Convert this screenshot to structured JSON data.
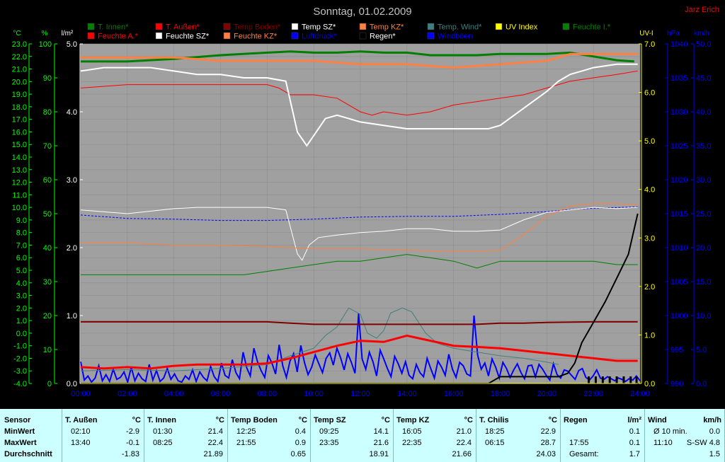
{
  "header": {
    "date_title": "Sonntag, 01.02.2009",
    "author": "Jarz Erich"
  },
  "colors": {
    "t_innen": "#007f00",
    "t_aussen": "#ff0000",
    "temp_boden": "#7f0000",
    "temp_sz": "#ffffff",
    "temp_kz": "#ff8040",
    "temp_wind": "#407f7f",
    "uv_index": "#ffff00",
    "feuchte_i": "#007f00",
    "feuchte_a": "#ff0000",
    "feuchte_sz": "#ffffff",
    "feuchte_kz": "#ff8040",
    "luftdruck": "#0000ff",
    "regen": "#000000",
    "windboeen": "#0000ff",
    "plot_bg": "#a0a0a0",
    "axis_green": "#00ff00",
    "axis_yellow": "#ffff00",
    "axis_blue": "#0000ff"
  },
  "legend": [
    {
      "label": "T. Innen*",
      "color": "#007f00"
    },
    {
      "label": "T. Außen*",
      "color": "#ff0000"
    },
    {
      "label": "Temp Boden*",
      "color": "#7f0000"
    },
    {
      "label": "Temp SZ*",
      "color": "#ffffff"
    },
    {
      "label": "Temp KZ*",
      "color": "#ff8040"
    },
    {
      "label": "Temp. Wind*",
      "color": "#407f7f"
    },
    {
      "label": "UV Index",
      "color": "#ffff00"
    },
    {
      "label": "Feuchte I.*",
      "color": "#007f00"
    },
    {
      "label": "Feuchte A.*",
      "color": "#ff0000"
    },
    {
      "label": "Feuchte SZ*",
      "color": "#ffffff"
    },
    {
      "label": "Feuchte KZ*",
      "color": "#ff8040"
    },
    {
      "label": "Luftdruck*",
      "color": "#0000ff"
    },
    {
      "label": "Regen*",
      "color": "#000000"
    },
    {
      "label": "Windböen",
      "color": "#0000ff"
    }
  ],
  "axis_units": {
    "temp": "°C",
    "humidity": "%",
    "rain": "l/m²",
    "uv": "UV-I",
    "pressure": "hPa",
    "wind": "km/h"
  },
  "chart_data": {
    "type": "line",
    "title": "Sonntag, 01.02.2009",
    "x_ticks": [
      "00:00",
      "02:00",
      "04:00",
      "06:00",
      "08:00",
      "10:00",
      "12:00",
      "14:00",
      "16:00",
      "18:00",
      "20:00",
      "22:00",
      "24:00"
    ],
    "axes": {
      "temp_c": {
        "range": [
          -4.0,
          23.0
        ],
        "ticks": [
          "23.0",
          "22.0",
          "21.0",
          "20.0",
          "19.0",
          "18.0",
          "17.0",
          "16.0",
          "15.0",
          "14.0",
          "13.0",
          "12.0",
          "11.0",
          "10.0",
          "9.0",
          "8.0",
          "7.0",
          "6.0",
          "5.0",
          "4.0",
          "3.0",
          "2.0",
          "1.0",
          "0.0",
          "-1.0",
          "-2.0",
          "-3.0",
          "-4.0"
        ]
      },
      "humidity_pct": {
        "range": [
          0,
          100
        ],
        "ticks": [
          "100",
          "90",
          "80",
          "70",
          "60",
          "50",
          "40",
          "30",
          "20",
          "10",
          "0"
        ]
      },
      "rain_lm2": {
        "range": [
          0,
          5
        ],
        "ticks": [
          "5.0",
          "4.0",
          "3.0",
          "2.0",
          "1.0",
          "0.0"
        ]
      },
      "uv": {
        "range": [
          0,
          7
        ],
        "ticks": [
          "7.0",
          "6.0",
          "5.0",
          "4.0",
          "3.0",
          "2.0",
          "1.0",
          "0.0"
        ]
      },
      "pressure_hpa": {
        "range": [
          990,
          1040
        ],
        "ticks": [
          "1040",
          "1035",
          "1030",
          "1025",
          "1020",
          "1015",
          "1010",
          "1005",
          "1000",
          "995",
          "990"
        ]
      },
      "wind_kmh": {
        "range": [
          0,
          50
        ],
        "ticks": [
          "50.0",
          "45.0",
          "40.0",
          "35.0",
          "30.0",
          "25.0",
          "20.0",
          "15.0",
          "10.0",
          "5.0",
          "0.0"
        ]
      }
    },
    "series": [
      {
        "name": "T. Innen*",
        "axis": "temp_c",
        "color": "#007f00",
        "width": 3,
        "x": [
          0,
          2,
          4,
          6,
          8,
          9,
          10,
          11,
          12,
          13,
          14,
          15,
          16,
          17,
          18,
          19,
          20,
          21,
          22,
          23,
          23.75
        ],
        "y": [
          21.6,
          21.6,
          21.8,
          22.1,
          22.3,
          22.4,
          22.3,
          22.3,
          22.4,
          22.3,
          22.3,
          22.1,
          22.1,
          22.1,
          22.2,
          22.2,
          22.2,
          22.3,
          22.0,
          21.7,
          21.6
        ]
      },
      {
        "name": "Feuchte A.*",
        "axis": "humidity_pct",
        "color": "#ff0000",
        "width": 1,
        "x": [
          0,
          2,
          4,
          6,
          8,
          8.5,
          9,
          10,
          11,
          12,
          12.5,
          13,
          14,
          15,
          16,
          17,
          18,
          19,
          20,
          21,
          22,
          23,
          23.9
        ],
        "y": [
          87,
          88,
          88,
          88,
          88,
          87,
          85,
          85,
          84,
          80,
          79,
          80,
          79,
          80,
          82,
          83,
          84,
          85,
          87,
          89,
          90,
          91,
          92
        ]
      },
      {
        "name": "Feuchte KZ*",
        "axis": "humidity_pct",
        "color": "#ff8040",
        "width": 3,
        "x": [
          0,
          2,
          4,
          6,
          8,
          10,
          12,
          14,
          16,
          18,
          20,
          21,
          22,
          23,
          23.9
        ],
        "y": [
          96,
          96,
          96,
          95,
          95,
          95,
          94,
          94,
          93,
          94,
          95,
          97,
          97,
          97,
          97
        ]
      },
      {
        "name": "Feuchte SZ*",
        "axis": "humidity_pct",
        "color": "#ffffff",
        "width": 2,
        "x": [
          0,
          1,
          2,
          3,
          4,
          5,
          6,
          7,
          8,
          8.8,
          9.3,
          9.7,
          10,
          10.5,
          11,
          11.5,
          12,
          13,
          14,
          15,
          16,
          17,
          17.5,
          18,
          19,
          20,
          20.5,
          21,
          21.5,
          22,
          23,
          23.9
        ],
        "y": [
          92,
          93,
          93,
          93,
          92,
          91,
          91,
          90,
          90,
          89,
          74,
          70,
          73,
          78,
          79,
          78,
          77,
          76,
          75,
          75,
          75,
          75,
          75,
          76,
          81,
          86,
          89,
          91,
          92,
          93,
          94,
          94
        ]
      },
      {
        "name": "Luftdruck*",
        "axis": "pressure_hpa",
        "color": "#0000ff",
        "width": 1,
        "dashed": true,
        "x": [
          0,
          2,
          4,
          6,
          8,
          10,
          12,
          14,
          16,
          18,
          20,
          21,
          22,
          23,
          23.9
        ],
        "y": [
          1014.8,
          1014.3,
          1014.2,
          1014.0,
          1014.0,
          1014.2,
          1014.5,
          1014.6,
          1014.6,
          1014.9,
          1015.3,
          1015.6,
          1015.8,
          1015.9,
          1016.0
        ]
      },
      {
        "name": "Temp SZ*",
        "axis": "temp_c",
        "color": "#ffffff",
        "width": 1,
        "x": [
          0,
          2,
          4,
          5,
          6,
          7,
          8,
          8.8,
          9.3,
          9.5,
          9.8,
          10.2,
          11,
          12,
          13,
          14,
          15,
          16,
          17,
          18,
          19,
          20,
          21,
          22,
          23,
          23.9
        ],
        "y": [
          9.8,
          9.5,
          9.9,
          10.0,
          10.0,
          10.0,
          10.0,
          9.8,
          6.3,
          5.8,
          7.0,
          7.6,
          7.8,
          8.0,
          8.1,
          8.3,
          8.3,
          8.1,
          8.1,
          8.2,
          9.0,
          9.6,
          9.8,
          10.0,
          9.9,
          10.0
        ]
      },
      {
        "name": "Temp KZ*",
        "axis": "temp_c",
        "color": "#ff8040",
        "width": 1,
        "x": [
          0,
          2,
          4,
          6,
          8,
          9,
          10,
          12,
          14,
          16,
          17,
          18,
          19,
          20,
          21,
          22,
          23,
          23.9
        ],
        "y": [
          7.2,
          7.2,
          7.0,
          7.0,
          6.9,
          6.8,
          6.7,
          6.7,
          6.6,
          6.5,
          6.5,
          6.6,
          7.8,
          9.3,
          10.1,
          10.3,
          10.3,
          10.2
        ]
      },
      {
        "name": "Feuchte I.*",
        "axis": "humidity_pct",
        "color": "#007f00",
        "width": 1,
        "x": [
          0,
          2,
          4,
          6,
          7,
          8,
          9,
          10,
          11,
          12,
          13,
          14,
          15,
          16,
          17,
          18,
          19,
          20,
          21,
          22,
          23,
          23.9
        ],
        "y": [
          32,
          32,
          32,
          32,
          32,
          33,
          34,
          35,
          36,
          36,
          37,
          38,
          37,
          36,
          34,
          36,
          36,
          36,
          36,
          36,
          35,
          35
        ]
      },
      {
        "name": "Temp. Wind*",
        "axis": "temp_c",
        "color": "#407f7f",
        "width": 1,
        "x": [
          0,
          2,
          4,
          6,
          8,
          9,
          10,
          10.5,
          11,
          11.5,
          12,
          12.3,
          12.7,
          13,
          13.3,
          13.8,
          14.2,
          14.8,
          15.3,
          16,
          17,
          18,
          19,
          20,
          20.5
        ],
        "y": [
          -3.0,
          -2.9,
          -3.0,
          -2.8,
          -2.5,
          -1.8,
          -1.2,
          -0.2,
          0.5,
          2.0,
          1.5,
          0.0,
          -0.4,
          0.2,
          1.6,
          2.0,
          1.7,
          0.0,
          -0.8,
          -1.2,
          -1.5,
          -1.8,
          -2.0,
          -2.3,
          -2.5
        ]
      },
      {
        "name": "Temp Boden*",
        "axis": "temp_c",
        "color": "#7f0000",
        "width": 2,
        "x": [
          0,
          2,
          4,
          6,
          8,
          9,
          10,
          12,
          14,
          16,
          17,
          18,
          19,
          20,
          22,
          23.9
        ],
        "y": [
          0.9,
          0.9,
          0.9,
          0.9,
          0.9,
          0.8,
          0.7,
          0.7,
          0.7,
          0.7,
          0.7,
          0.8,
          0.8,
          0.85,
          0.9,
          0.9
        ]
      },
      {
        "name": "T. Außen*",
        "axis": "temp_c",
        "color": "#ff0000",
        "width": 3,
        "x": [
          0,
          1,
          2,
          3,
          4,
          5,
          6,
          7,
          8,
          9,
          10,
          11,
          12,
          13,
          14,
          15,
          16,
          17,
          18,
          19,
          20,
          21,
          22,
          23,
          23.9
        ],
        "y": [
          -2.7,
          -2.8,
          -2.7,
          -2.8,
          -2.6,
          -2.5,
          -2.5,
          -2.5,
          -2.4,
          -2.0,
          -1.5,
          -1.0,
          -0.6,
          -0.7,
          -0.2,
          -0.6,
          -1.0,
          -1.1,
          -1.2,
          -1.4,
          -1.6,
          -1.8,
          -2.0,
          -2.2,
          -2.2
        ]
      },
      {
        "name": "Regen*",
        "axis": "rain_lm2",
        "color": "#000000",
        "width": 2,
        "x": [
          0,
          17.5,
          18,
          20.5,
          20.9,
          21.2,
          21.5,
          22,
          22.5,
          23,
          23.5,
          23.9
        ],
        "y": [
          0,
          0,
          0.1,
          0.1,
          0.15,
          0.3,
          0.6,
          0.9,
          1.2,
          1.55,
          1.9,
          2.5
        ]
      },
      {
        "name": "UV Index",
        "axis": "uv",
        "color": "#ffff00",
        "width": 1,
        "x": [
          0,
          23.9
        ],
        "y": [
          0,
          0
        ]
      }
    ],
    "windboeen_kmh": [
      3.2,
      0.5,
      1.1,
      0.2,
      0.8,
      2.6,
      0.4,
      1.3,
      0.3,
      2.1,
      0.6,
      0.9,
      1.7,
      0.2,
      2.4,
      0.4,
      1.5,
      0.7,
      0.3,
      2.8,
      0.5,
      1.9,
      0.3,
      0.8,
      2.2,
      0.6,
      1.4,
      0.4,
      0.2,
      1.1,
      0.6,
      2.0,
      0.3,
      1.7,
      0.9,
      0.4,
      2.5,
      1.0,
      0.3,
      3.0,
      1.2,
      0.8,
      3.5,
      1.6,
      0.7,
      4.6,
      2.3,
      1.1,
      5.2,
      3.2,
      1.9,
      0.9,
      4.1,
      3.0,
      1.4,
      5.7,
      2.6,
      0.9,
      3.3,
      4.4,
      1.7,
      5.6,
      3.1,
      1.3,
      2.4,
      4.2,
      2.9,
      1.6,
      3.7,
      4.5,
      2.7,
      5.2,
      3.8,
      2.0,
      4.4,
      3.1,
      1.5,
      10.3,
      3.6,
      2.1,
      4.6,
      3.2,
      1.1,
      4.9,
      3.6,
      2.2,
      1.0,
      4.0,
      2.9,
      1.5,
      3.2,
      1.2,
      0.7,
      2.8,
      1.6,
      1.0,
      3.7,
      2.2,
      0.8,
      3.3,
      2.4,
      1.2,
      4.3,
      2.1,
      0.9,
      3.1,
      2.6,
      1.4,
      1.1,
      10.0,
      4.2,
      2.1,
      3.0,
      1.1,
      3.6,
      2.4,
      0.8,
      3.1,
      2.2,
      0.9,
      2.0,
      2.9,
      1.6,
      0.7,
      2.6,
      2.7,
      1.0,
      2.8,
      2.1,
      1.2,
      0.5,
      2.9,
      1.3,
      0.8,
      2.0,
      1.8,
      1.2,
      0.6,
      1.9,
      2.2,
      0.9,
      0.5,
      1.1,
      2.0,
      0.8,
      0.6,
      1.0,
      0.7,
      0.4,
      0.8,
      0.6,
      0.3,
      0.7,
      0.5,
      1.1,
      0.4
    ],
    "wind_avg_marks_x": [
      21.8,
      22.1,
      22.4,
      22.7,
      23.0,
      23.3,
      23.6,
      23.85
    ]
  },
  "stats": {
    "sensor_label": "Sensor",
    "min_label": "MinWert",
    "max_label": "MaxWert",
    "avg_label": "Durchschnitt",
    "columns": [
      {
        "name": "T. Außen",
        "unit": "°C",
        "min_time": "02:10",
        "min": "-2.9",
        "max_time": "13:40",
        "max": "-0.1",
        "avg": "-1.83"
      },
      {
        "name": "T. Innen",
        "unit": "°C",
        "min_time": "01:30",
        "min": "21.4",
        "max_time": "08:25",
        "max": "22.4",
        "avg": "21.89"
      },
      {
        "name": "Temp Boden",
        "unit": "°C",
        "min_time": "12:25",
        "min": "0.4",
        "max_time": "21:55",
        "max": "0.9",
        "avg": "0.65"
      },
      {
        "name": "Temp SZ",
        "unit": "°C",
        "min_time": "09:25",
        "min": "14.1",
        "max_time": "23:35",
        "max": "21.6",
        "avg": "18.91"
      },
      {
        "name": "Temp KZ",
        "unit": "°C",
        "min_time": "16:05",
        "min": "21.0",
        "max_time": "22:35",
        "max": "22.4",
        "avg": "21.66"
      },
      {
        "name": "T. Chilis",
        "unit": "°C",
        "min_time": "18:25",
        "min": "22.9",
        "max_time": "06:15",
        "max": "28.7",
        "avg": "24.03"
      }
    ],
    "regen": {
      "name": "Regen",
      "unit": "l/m²",
      "row1_time": "",
      "row1_val": "0.1",
      "row2_time": "17:55",
      "row2_val": "0.1",
      "row3_time": "Gesamt:",
      "row3_val": "1.7"
    },
    "wind": {
      "name": "Wind",
      "unit": "km/h",
      "row1_time": "Ø 10 min.",
      "row1_val": "0.0",
      "row2_time": "11:10",
      "row2_val": "S-SW 4.8",
      "row3_time": "",
      "row3_val": "1.5"
    }
  }
}
